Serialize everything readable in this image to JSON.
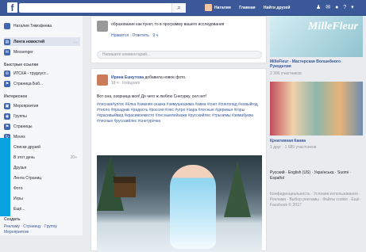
{
  "topbar": {
    "logo": "f",
    "search_icon": "search-icon",
    "nav": [
      "Наталия",
      "Главная",
      "Найти друзей"
    ],
    "icons": [
      "friends-icon",
      "messages-icon",
      "notifications-icon",
      "help-icon",
      "dropdown-icon"
    ]
  },
  "left": {
    "profile": "Наталия Тимофеева",
    "news": "Лента новостей",
    "messenger": "Messenger",
    "quick_links": "Быстрые ссылки",
    "links": [
      "ИГСХА - трудоуст...",
      "Страница Баб..."
    ],
    "interest": "Интересное",
    "items": [
      "Мероприятия",
      "Группы",
      "Страницы",
      "Moves",
      "Списки друзей",
      "В этот день",
      "Друзья",
      "Лента Страниц",
      "Фото",
      "Игры",
      "Ещё..."
    ],
    "create": "Создать",
    "create_links": [
      "Рекламу",
      "Страницу",
      "Группу",
      "Мероприятие"
    ],
    "counts": [
      "...",
      "20+"
    ]
  },
  "post_top": {
    "text": "образование как пункт, то в программу вашего исследования",
    "actions": "Нравится · Ответить · 9 ч",
    "comment_placeholder": "Напишите комментарий..."
  },
  "post": {
    "author": "Ирина Ешкутова",
    "action": " добавила новое фото.",
    "meta": "18 ч · Instagram",
    "text": "Вот она, озорница моя! До чего ж люблю Снегурку, сил нет!",
    "hashtags": "#лесная#улгос #ёлка #зимняя сказка #зимушказима #зима #снег #снегопад #новыйгод #тепло #праздник #радость #россия #лес #утро #зара #лесные #деревья #горы #красивыйвид #красивоеместо #лесныепейзажи #русскийлес #трызимы #зимабуква #лесные #русскийлес #снегурочка"
  },
  "right": {
    "ad1_title": "MilleFleur - Мастерская Волшебного Рукоделия",
    "ad1_meta": "2 396 участников",
    "ad2_title": "Креативная Канва",
    "ad2_meta": "1 друг · 1 689 участников",
    "languages": "Русский · English (US) · Українська · Suomi · Español",
    "footer": "Конфиденциальность · Условия использования · Реклама · Выбор рекламы · Файлы cookie · Ещё · Facebook © 2017"
  }
}
